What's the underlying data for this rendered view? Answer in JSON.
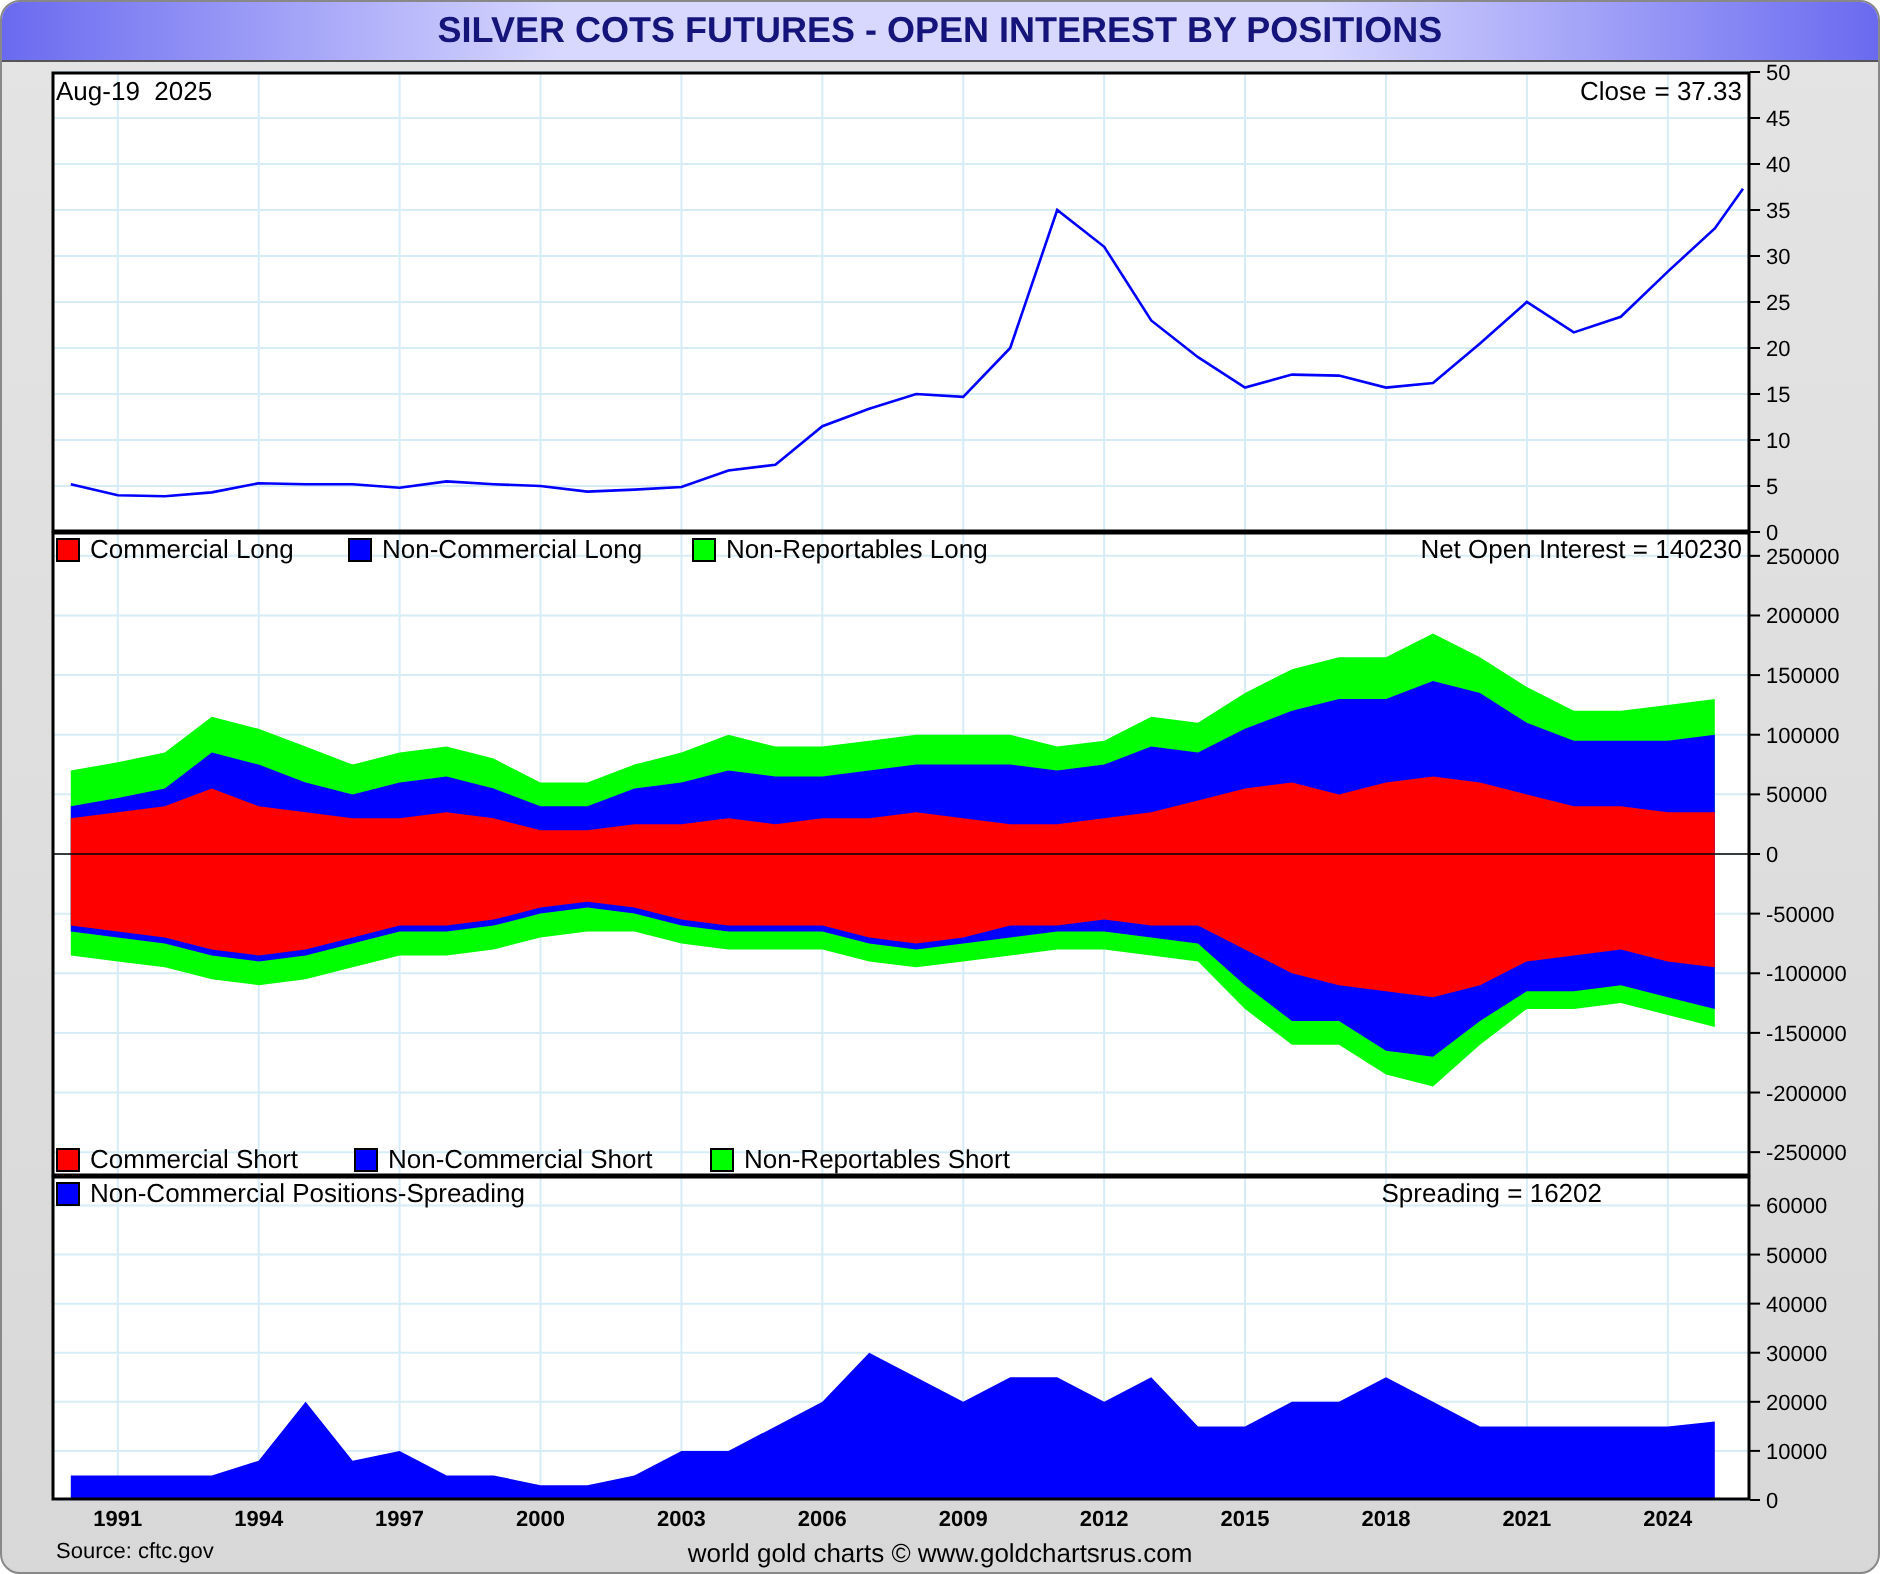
{
  "title": "SILVER COTS FUTURES - OPEN INTEREST BY POSITIONS",
  "panels": [
    {
      "kind": "price",
      "date": "Aug-19  2025",
      "reading": "= 37.33",
      "chart_data": {
        "type": "line",
        "grid": true,
        "xlim": [
          1989.6,
          2025.75
        ],
        "ylim": [
          0,
          50
        ],
        "yticks": [
          0,
          5,
          10,
          15,
          20,
          25,
          30,
          35,
          40,
          45,
          50
        ],
        "x": [
          1990,
          1991,
          1992,
          1993,
          1994,
          1995,
          1996,
          1997,
          1998,
          1999,
          2000,
          2001,
          2002,
          2003,
          2004,
          2005,
          2006,
          2007,
          2008,
          2009,
          2010,
          2011,
          2012,
          2013,
          2014,
          2015,
          2016,
          2017,
          2018,
          2019,
          2020,
          2021,
          2022,
          2023,
          2024,
          2025,
          2025.6
        ],
        "series": [
          {
            "name": "Close",
            "color": "#0000ff",
            "values": [
              5.2,
              4.0,
              3.9,
              4.3,
              5.3,
              5.2,
              5.2,
              4.8,
              5.5,
              5.2,
              5.0,
              4.4,
              4.6,
              4.9,
              6.7,
              7.3,
              11.5,
              13.4,
              15.0,
              14.7,
              20.0,
              35.0,
              31.0,
              23.0,
              19.0,
              15.7,
              17.1,
              17.0,
              15.7,
              16.2,
              20.5,
              25.0,
              21.7,
              23.4,
              28.3,
              33.0,
              37.3
            ]
          }
        ]
      }
    },
    {
      "kind": "positions",
      "reading": "Net Open Interest = 140230",
      "chart_data": {
        "type": "area",
        "grid": true,
        "xlim": [
          1989.6,
          2025.75
        ],
        "ylim": [
          -270000,
          270000
        ],
        "yticks": [
          -250000,
          -200000,
          -150000,
          -100000,
          -50000,
          0,
          50000,
          100000,
          150000,
          200000,
          250000
        ],
        "x": [
          1990,
          1991,
          1992,
          1993,
          1994,
          1995,
          1996,
          1997,
          1998,
          1999,
          2000,
          2001,
          2002,
          2003,
          2004,
          2005,
          2006,
          2007,
          2008,
          2009,
          2010,
          2011,
          2012,
          2013,
          2014,
          2015,
          2016,
          2017,
          2018,
          2019,
          2020,
          2021,
          2022,
          2023,
          2024,
          2025
        ],
        "series": [
          {
            "name": "Commercial Long",
            "color": "#ff0000",
            "values": [
              30000,
              35000,
              40000,
              55000,
              40000,
              35000,
              30000,
              30000,
              35000,
              30000,
              20000,
              20000,
              25000,
              25000,
              30000,
              25000,
              30000,
              30000,
              35000,
              30000,
              25000,
              25000,
              30000,
              35000,
              45000,
              55000,
              60000,
              50000,
              60000,
              65000,
              60000,
              50000,
              40000,
              40000,
              35000,
              35000
            ]
          },
          {
            "name": "Non-Commercial Long",
            "color": "#0000ff",
            "values": [
              40000,
              47000,
              55000,
              85000,
              75000,
              60000,
              50000,
              60000,
              65000,
              55000,
              40000,
              40000,
              55000,
              60000,
              70000,
              65000,
              65000,
              70000,
              75000,
              75000,
              75000,
              70000,
              75000,
              90000,
              85000,
              105000,
              120000,
              130000,
              130000,
              145000,
              135000,
              110000,
              95000,
              95000,
              95000,
              100000
            ]
          },
          {
            "name": "Non-Reportables Long",
            "color": "#00ff00",
            "values": [
              70000,
              77000,
              85000,
              115000,
              105000,
              90000,
              75000,
              85000,
              90000,
              80000,
              60000,
              60000,
              75000,
              85000,
              100000,
              90000,
              90000,
              95000,
              100000,
              100000,
              100000,
              90000,
              95000,
              115000,
              110000,
              135000,
              155000,
              165000,
              165000,
              185000,
              165000,
              140000,
              120000,
              120000,
              125000,
              130000
            ]
          },
          {
            "name": "Commercial Short",
            "color": "#ff0000",
            "values": [
              -60000,
              -65000,
              -70000,
              -80000,
              -85000,
              -80000,
              -70000,
              -60000,
              -60000,
              -55000,
              -45000,
              -40000,
              -45000,
              -55000,
              -60000,
              -60000,
              -60000,
              -70000,
              -75000,
              -70000,
              -60000,
              -60000,
              -55000,
              -60000,
              -60000,
              -80000,
              -100000,
              -110000,
              -115000,
              -120000,
              -110000,
              -90000,
              -85000,
              -80000,
              -90000,
              -95000
            ]
          },
          {
            "name": "Non-Commercial Short",
            "color": "#0000ff",
            "values": [
              -65000,
              -70000,
              -75000,
              -85000,
              -90000,
              -85000,
              -75000,
              -65000,
              -65000,
              -60000,
              -50000,
              -45000,
              -50000,
              -60000,
              -65000,
              -65000,
              -65000,
              -75000,
              -80000,
              -75000,
              -70000,
              -65000,
              -65000,
              -70000,
              -75000,
              -110000,
              -140000,
              -140000,
              -165000,
              -170000,
              -140000,
              -115000,
              -115000,
              -110000,
              -120000,
              -130000
            ]
          },
          {
            "name": "Non-Reportables Short",
            "color": "#00ff00",
            "values": [
              -85000,
              -90000,
              -95000,
              -105000,
              -110000,
              -105000,
              -95000,
              -85000,
              -85000,
              -80000,
              -70000,
              -65000,
              -65000,
              -75000,
              -80000,
              -80000,
              -80000,
              -90000,
              -95000,
              -90000,
              -85000,
              -80000,
              -80000,
              -85000,
              -90000,
              -130000,
              -160000,
              -160000,
              -185000,
              -195000,
              -160000,
              -130000,
              -130000,
              -125000,
              -135000,
              -145000
            ]
          }
        ]
      }
    },
    {
      "kind": "spreading",
      "reading": "Spreading = 16202",
      "chart_data": {
        "type": "area",
        "grid": true,
        "xlim": [
          1989.6,
          2025.75
        ],
        "ylim": [
          0,
          66000
        ],
        "yticks": [
          0,
          10000,
          20000,
          30000,
          40000,
          50000,
          60000
        ],
        "xticks": [
          1991,
          1994,
          1997,
          2000,
          2003,
          2006,
          2009,
          2012,
          2015,
          2018,
          2021,
          2024
        ],
        "x": [
          1990,
          1991,
          1992,
          1993,
          1994,
          1995,
          1996,
          1997,
          1998,
          1999,
          2000,
          2001,
          2002,
          2003,
          2004,
          2005,
          2006,
          2007,
          2008,
          2009,
          2010,
          2011,
          2012,
          2013,
          2014,
          2015,
          2016,
          2017,
          2018,
          2019,
          2020,
          2021,
          2022,
          2023,
          2024,
          2025
        ],
        "series": [
          {
            "name": "Non-Commercial Positions-Spreading",
            "color": "#0000ff",
            "values": [
              5000,
              5000,
              5000,
              5000,
              8000,
              20000,
              8000,
              10000,
              5000,
              5000,
              3000,
              3000,
              5000,
              10000,
              10000,
              15000,
              20000,
              30000,
              25000,
              20000,
              25000,
              25000,
              20000,
              25000,
              15000,
              15000,
              20000,
              20000,
              25000,
              20000,
              15000,
              15000,
              15000,
              15000,
              15000,
              16000
            ]
          }
        ]
      }
    }
  ],
  "source": "Source: cftc.gov",
  "credit": "world gold charts © www.goldchartsrus.com"
}
